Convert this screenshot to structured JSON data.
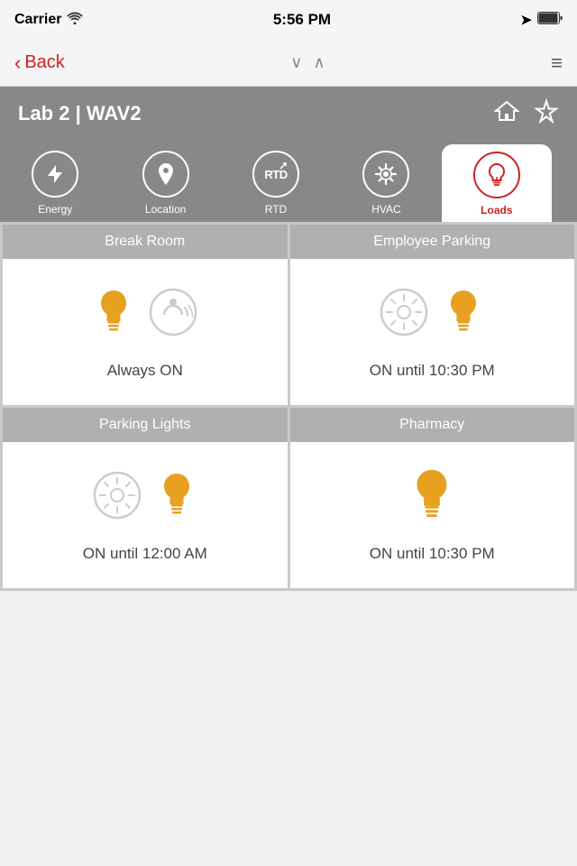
{
  "status_bar": {
    "carrier": "Carrier",
    "time": "5:56 PM"
  },
  "nav": {
    "back_label": "Back",
    "down_arrow": "∨",
    "up_arrow": "∧",
    "menu": "≡"
  },
  "header": {
    "title": "Lab 2 | WAV2",
    "home_icon": "home",
    "star_icon": "star"
  },
  "tabs": [
    {
      "id": "energy",
      "label": "Energy",
      "icon": "bolt",
      "active": false
    },
    {
      "id": "location",
      "label": "Location",
      "icon": "location",
      "active": false
    },
    {
      "id": "rtd",
      "label": "RTD",
      "icon": "rtd",
      "active": false
    },
    {
      "id": "hvac",
      "label": "HVAC",
      "icon": "fan",
      "active": false
    },
    {
      "id": "loads",
      "label": "Loads",
      "icon": "bulb",
      "active": true
    }
  ],
  "cards": [
    {
      "title": "Break Room",
      "icons": [
        "bulb",
        "motion"
      ],
      "status": "Always ON"
    },
    {
      "title": "Employee Parking",
      "icons": [
        "sun-sensor",
        "bulb"
      ],
      "status": "ON until 10:30 PM"
    },
    {
      "title": "Parking Lights",
      "icons": [
        "sun-sensor",
        "bulb"
      ],
      "status": "ON until 12:00 AM"
    },
    {
      "title": "Pharmacy",
      "icons": [
        "bulb"
      ],
      "status": "ON until 10:30 PM"
    }
  ]
}
